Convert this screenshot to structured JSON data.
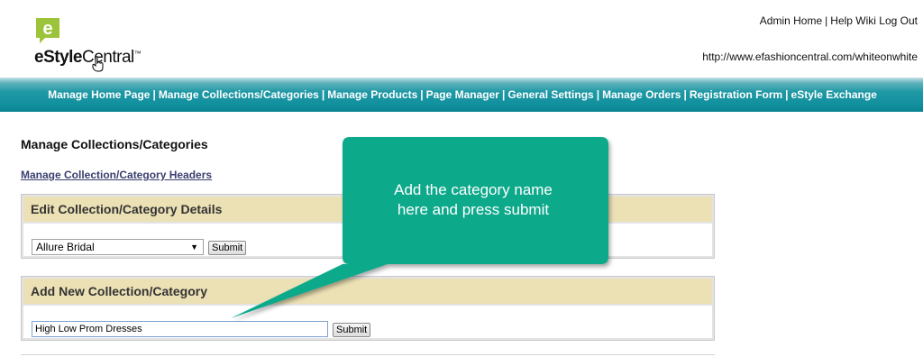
{
  "logo": {
    "brand_bold": "eStyle",
    "brand_rest": "Central",
    "trademark": "™"
  },
  "top_links": [
    {
      "label": "Admin Home"
    },
    {
      "label": "Help Wiki"
    },
    {
      "label": "Log Out"
    }
  ],
  "site_url": "http://www.efashioncentral.com/whiteonwhite",
  "nav": [
    {
      "label": "Manage Home Page"
    },
    {
      "label": "Manage Collections/Categories"
    },
    {
      "label": "Manage Products"
    },
    {
      "label": "Page Manager"
    },
    {
      "label": "General Settings"
    },
    {
      "label": "Manage Orders"
    },
    {
      "label": "Registration Form"
    },
    {
      "label": "eStyle Exchange"
    }
  ],
  "page": {
    "title": "Manage Collections/Categories",
    "headers_link": "Manage Collection/Category Headers"
  },
  "edit_panel": {
    "title": "Edit Collection/Category Details",
    "selected_value": "Allure Bridal",
    "submit_label": "Submit"
  },
  "add_panel": {
    "title": "Add New Collection/Category",
    "input_value": "High Low Prom Dresses",
    "submit_label": "Submit"
  },
  "callout": {
    "text_line1": "Add the category name",
    "text_line2": "here and press submit",
    "color": "#0aa98b"
  },
  "colors": {
    "nav_bar": "#12909e",
    "panel_header": "#ece0b5",
    "logo_green": "#9cc43b"
  }
}
